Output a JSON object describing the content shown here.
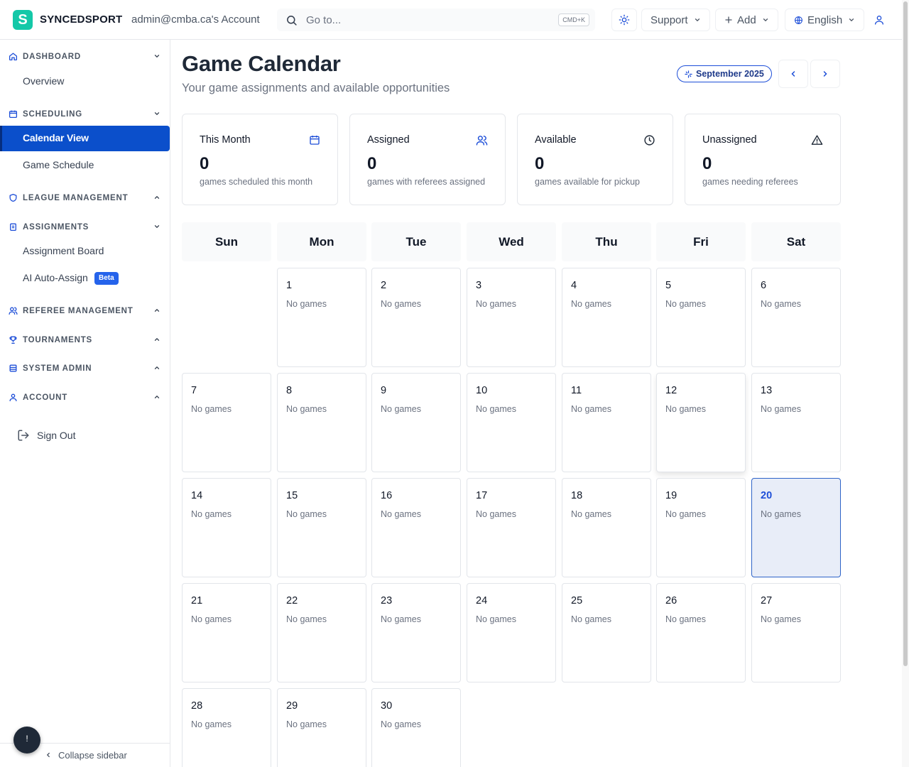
{
  "topbar": {
    "logo_letter": "S",
    "brand": "SYNCEDSPORT",
    "account": "admin@cmba.ca's Account",
    "search_placeholder": "Go to...",
    "search_shortcut": "CMD+K",
    "support_label": "Support",
    "add_label": "Add",
    "language_label": "English"
  },
  "sidebar": {
    "sections": {
      "dashboard": "DASHBOARD",
      "scheduling": "SCHEDULING",
      "league_management": "LEAGUE MANAGEMENT",
      "assignments": "ASSIGNMENTS",
      "referee_management": "REFEREE MANAGEMENT",
      "tournaments": "TOURNAMENTS",
      "system_admin": "SYSTEM ADMIN",
      "account": "ACCOUNT"
    },
    "items": {
      "overview": "Overview",
      "calendar_view": "Calendar View",
      "game_schedule": "Game Schedule",
      "assignment_board": "Assignment Board",
      "ai_auto_assign": "AI Auto-Assign",
      "beta_badge": "Beta"
    },
    "sign_out": "Sign Out",
    "collapse": "Collapse sidebar",
    "help_button": "!"
  },
  "page": {
    "title": "Game Calendar",
    "subtitle": "Your game assignments and available opportunities",
    "month_label": "September 2025"
  },
  "stats": [
    {
      "title": "This Month",
      "value": "0",
      "desc": "games scheduled this month",
      "icon": "calendar-icon"
    },
    {
      "title": "Assigned",
      "value": "0",
      "desc": "games with referees assigned",
      "icon": "users-icon"
    },
    {
      "title": "Available",
      "value": "0",
      "desc": "games available for pickup",
      "icon": "clock-icon"
    },
    {
      "title": "Unassigned",
      "value": "0",
      "desc": "games needing referees",
      "icon": "alert-triangle-icon"
    }
  ],
  "calendar": {
    "weekdays": [
      "Sun",
      "Mon",
      "Tue",
      "Wed",
      "Thu",
      "Fri",
      "Sat"
    ],
    "first_weekday_index": 1,
    "days_in_month": 30,
    "today": 20,
    "empty_label": "No games",
    "days": [
      "1",
      "2",
      "3",
      "4",
      "5",
      "6",
      "7",
      "8",
      "9",
      "10",
      "11",
      "12",
      "13",
      "14",
      "15",
      "16",
      "17",
      "18",
      "19",
      "20",
      "21",
      "22",
      "23",
      "24",
      "25",
      "26",
      "27",
      "28",
      "29",
      "30"
    ]
  },
  "colors": {
    "brand_teal": "#14c8a8",
    "active_nav": "#0b4fcb",
    "accent_blue": "#1d4ed8",
    "today_bg": "#e8edf8",
    "beta_badge": "#2563eb"
  }
}
